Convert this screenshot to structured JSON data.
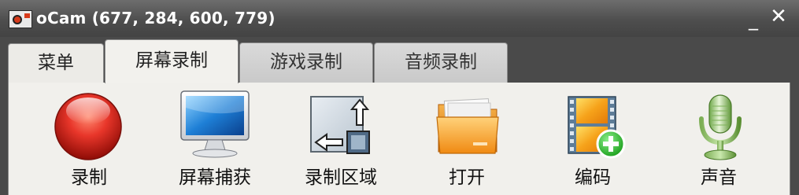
{
  "window": {
    "title": "oCam (677, 284, 600, 779)",
    "minimize_label": "_",
    "close_label": "✕"
  },
  "tabs": [
    {
      "label": "菜单",
      "active": false
    },
    {
      "label": "屏幕录制",
      "active": true
    },
    {
      "label": "游戏录制",
      "active": false
    },
    {
      "label": "音频录制",
      "active": false
    }
  ],
  "toolbar": [
    {
      "label": "录制",
      "icon": "record-icon"
    },
    {
      "label": "屏幕捕获",
      "icon": "monitor-icon"
    },
    {
      "label": "录制区域",
      "icon": "resize-area-icon"
    },
    {
      "label": "打开",
      "icon": "folder-icon"
    },
    {
      "label": "编码",
      "icon": "film-add-icon"
    },
    {
      "label": "声音",
      "icon": "microphone-icon"
    }
  ],
  "colors": {
    "titlebar": "#4e4e4e",
    "panel": "#f1f0ec",
    "record_red": "#d8281e"
  }
}
